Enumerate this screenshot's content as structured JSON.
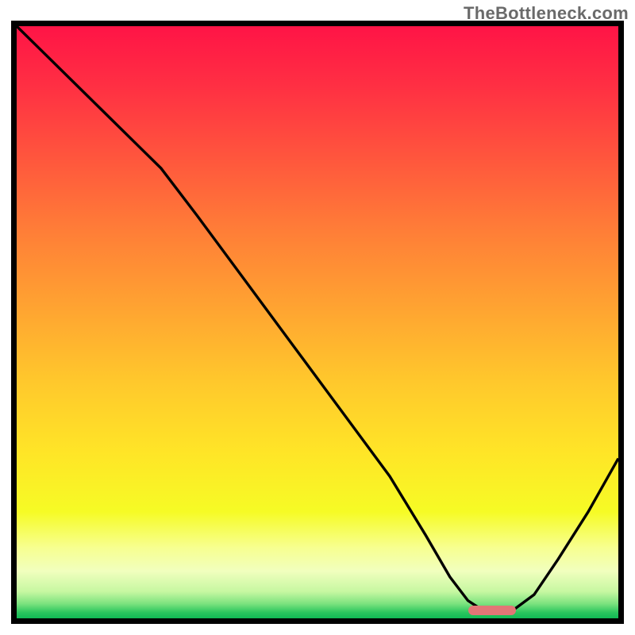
{
  "watermark": "TheBottleneck.com",
  "chart_data": {
    "type": "line",
    "title": "",
    "xlabel": "",
    "ylabel": "",
    "xlim": [
      0,
      100
    ],
    "ylim": [
      0,
      100
    ],
    "grid": false,
    "legend": false,
    "background": {
      "type": "vertical-gradient",
      "stops": [
        {
          "offset": 0.0,
          "color": "#ff1446"
        },
        {
          "offset": 0.1,
          "color": "#ff2f43"
        },
        {
          "offset": 0.22,
          "color": "#ff553d"
        },
        {
          "offset": 0.35,
          "color": "#ff7f37"
        },
        {
          "offset": 0.48,
          "color": "#ffa531"
        },
        {
          "offset": 0.6,
          "color": "#ffc82c"
        },
        {
          "offset": 0.72,
          "color": "#ffe527"
        },
        {
          "offset": 0.82,
          "color": "#f6fb25"
        },
        {
          "offset": 0.88,
          "color": "#f7ff8f"
        },
        {
          "offset": 0.92,
          "color": "#f1ffbe"
        },
        {
          "offset": 0.955,
          "color": "#c6f7a1"
        },
        {
          "offset": 0.975,
          "color": "#7de37f"
        },
        {
          "offset": 0.99,
          "color": "#2bc65e"
        },
        {
          "offset": 1.0,
          "color": "#11b955"
        }
      ]
    },
    "series": [
      {
        "name": "bottleneck-curve",
        "color": "#000000",
        "stroke_width": 3.4,
        "x": [
          0,
          4,
          12,
          20,
          24,
          30,
          38,
          46,
          54,
          62,
          68,
          72,
          75,
          78,
          82,
          86,
          90,
          95,
          100
        ],
        "y": [
          100,
          96,
          88,
          80,
          76,
          68,
          57,
          46,
          35,
          24,
          14,
          7,
          3,
          1,
          1,
          4,
          10,
          18,
          27
        ]
      }
    ],
    "annotations": [
      {
        "name": "optimal-range-marker",
        "type": "rounded-bar",
        "color": "#e27676",
        "x0": 75,
        "x1": 83,
        "y": 1.4,
        "height_pct": 1.6
      }
    ]
  }
}
